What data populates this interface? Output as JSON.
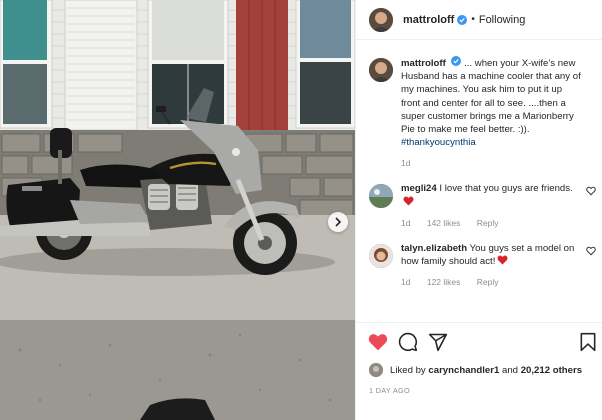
{
  "post": {
    "username": "mattroloff",
    "follow_status": "Following",
    "separator": "•",
    "more_label": "•••",
    "caption_user": "mattroloff",
    "caption_text": "... when your X-wife’s new Husband has a machine cooler that any of my machines. You ask him to put it up front and center for all to see. ....then a super customer brings me a Marionberry Pie to make me feel better. :)).",
    "hashtag": "#thankyoucynthia",
    "caption_age": "1d"
  },
  "comments": [
    {
      "user": "megli24",
      "text": "I love that you guys are friends.",
      "age": "1d",
      "likes": "142 likes",
      "reply": "Reply"
    },
    {
      "user": "talyn.elizabeth",
      "text": "You guys set a model on how family should act!",
      "age": "1d",
      "likes": "122 likes",
      "reply": "Reply"
    }
  ],
  "likes": {
    "prefix": "Liked by",
    "user": "carynchandler1",
    "middle": "and",
    "count": "20,212 others"
  },
  "timestamp": "1 DAY AGO",
  "colors": {
    "like_red": "#ed4956",
    "verified_blue": "#3897f0",
    "hashtag_blue": "#00376b",
    "meta_gray": "#8e8e8e"
  },
  "icons": [
    "heart-icon",
    "comment-icon",
    "share-icon",
    "bookmark-icon",
    "verified-badge-icon",
    "chevron-right-icon"
  ]
}
